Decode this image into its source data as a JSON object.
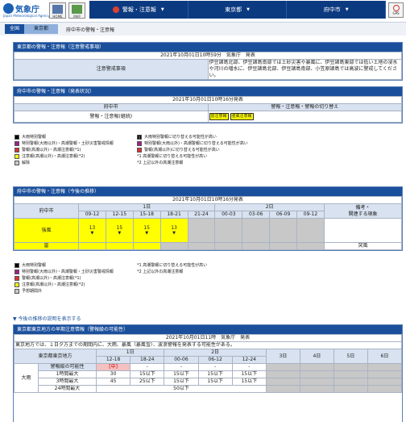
{
  "header": {
    "logo_text": "気象庁",
    "logo_en": "Japan Meteorological Agency",
    "home": "HOME",
    "map": "MAP",
    "gps": "GPS",
    "nav": [
      "警報・注意報",
      "東京都",
      "府中市"
    ]
  },
  "breadcrumb": [
    "全国",
    "東京都",
    "府中市の警報・注意報"
  ],
  "s1": {
    "title": "東京都の警報・注意報（注意警戒事項）",
    "date": "2021年10月01日10時59分　気象庁　発表",
    "row_label": "注意警戒事項",
    "text": "伊豆諸島北部、伊豆諸島南部では土砂災害や暴風に、伊豆諸島東部では低い土地の浸水や河川の増水に、伊豆諸島北部、伊豆諸島南部、小笠原諸島では高波に警戒してください。"
  },
  "s2": {
    "title": "府中市の警報・注意報（発表状況）",
    "date": "2021年10月01日10時16分発表",
    "h1": "府中市",
    "h2": "警報・注意報・警報の切り替え",
    "row_label": "警報・注意報(継続)",
    "tags": [
      "雷注意報",
      "強風注意報"
    ]
  },
  "legend1": {
    "left": [
      "大雨特別警報",
      "特別警報(大雨以外)・高潮警報・土砂災害警戒情報",
      "警報(高潮以外)・高潮注意報(*1)",
      "注意報(高潮以外)・高潮注意報(*2)",
      "解除"
    ],
    "right": [
      "大雨特別警報に切り替える可能性が高い",
      "特別警報(大雨以外)・高潮警報に切り替える可能性が高い",
      "警報(高潮以外)に切り替える可能性が高い",
      "*1 高潮警報に切り替える可能性が高い",
      "*2 上記以外の高潮注意報"
    ]
  },
  "s3": {
    "title": "府中市の警報・注意報（今後の推移）",
    "date": "2021年10月01日10時16分発表",
    "h_area": "府中市",
    "d1": "1日",
    "d2": "2日",
    "h_note": "備考・\n関連する現象",
    "times": [
      "09-12",
      "12-15",
      "15-18",
      "18-21",
      "21-24",
      "00-03",
      "03-06",
      "06-09",
      "09-12"
    ],
    "rows": [
      {
        "label": "強風",
        "vals": [
          "13",
          "15",
          "15",
          "13"
        ],
        "note": ""
      },
      {
        "label": "雷",
        "vals": [],
        "note": "突風"
      }
    ]
  },
  "legend2": {
    "left": [
      "大雨特別警報",
      "特別警報(大雨以外)・高潮警報・土砂災害警戒情報",
      "警報(高潮以外)・高潮注意報(*1)",
      "注意報(高潮以外)・高潮注意報(*2)",
      "予想期間外"
    ],
    "right": [
      "*1 高潮警報に切り替える可能性が高い",
      "*2 上記以外の高潮注意報"
    ]
  },
  "link": "▼ 今後の推移の説明を表示する",
  "s4": {
    "title": "東京都東京地方の早期注意情報（警報級の可能性）",
    "date": "2021年10月01日11時　気象庁　発表",
    "text": "東京地方では、１日夕方までの期間内に、大雨、暴風（暴風雪）、波浪警報を発表する可能性がある。",
    "h_area": "東京都東京地方",
    "d1": "1日",
    "d2": "2日",
    "d3": "3日",
    "d4": "4日",
    "d5": "5日",
    "d6": "6日",
    "times": [
      "12-18",
      "18-24",
      "00-06",
      "06-12",
      "12-24"
    ],
    "rows": [
      {
        "group": "",
        "label": "警報級の可能性",
        "vals": [
          "[中]",
          "-",
          "-",
          "-",
          "-"
        ]
      },
      {
        "group": "大雨",
        "label": "1時間最大",
        "vals": [
          "30",
          "15以下",
          "15以下",
          "15以下",
          "15以下"
        ]
      },
      {
        "group": "",
        "label": "3時間最大",
        "vals": [
          "45",
          "25以下",
          "15以下",
          "15以下",
          "15以下"
        ]
      },
      {
        "group": "",
        "label": "24時間最大",
        "vals": [
          "",
          "",
          "",
          "50以下",
          ""
        ]
      }
    ]
  }
}
